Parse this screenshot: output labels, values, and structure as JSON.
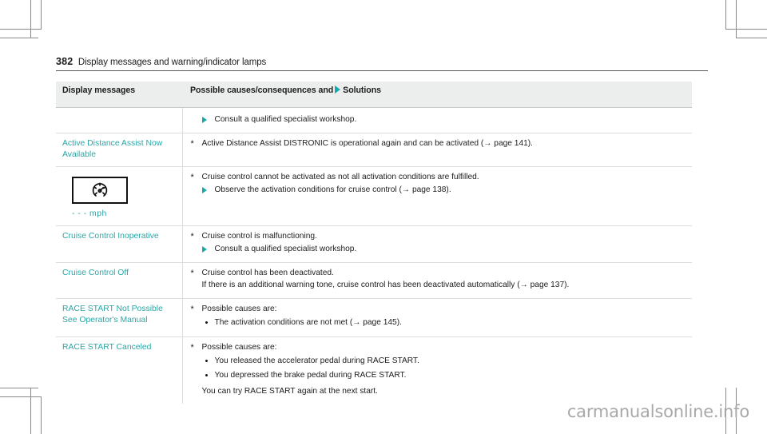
{
  "page": {
    "folio": "382",
    "running_title": "Display messages and warning/indicator lamps",
    "watermark": "carmanualsonline.info"
  },
  "colors": {
    "accent_teal": "#2aa7a6",
    "marker_teal": "#15a9a9",
    "header_bg": "#eceded",
    "rule": "#dcdddd",
    "text": "#1c1c1c"
  },
  "table": {
    "headers": {
      "col1": "Display messages",
      "col2_before": "Possible causes/consequences and",
      "col2_after": "Solutions"
    },
    "rows": [
      {
        "message": "",
        "icon": null,
        "lines": [
          {
            "kind": "solution",
            "text": "Consult a qualified specialist workshop."
          }
        ]
      },
      {
        "message": "Active Distance Assist Now Available",
        "icon": null,
        "lines": [
          {
            "kind": "star",
            "text": "Active Distance Assist DISTRONIC is operational again and can be activated (→ page 141)."
          }
        ]
      },
      {
        "message": "",
        "icon": {
          "name": "speedometer-icon",
          "unit_label": "- - - mph"
        },
        "lines": [
          {
            "kind": "star",
            "text": "Cruise control cannot be activated as not all activation conditions are fulfilled."
          },
          {
            "kind": "solution",
            "text": "Observe the activation conditions for cruise control (→ page 138)."
          }
        ]
      },
      {
        "message": "Cruise Control Inoperative",
        "icon": null,
        "lines": [
          {
            "kind": "star",
            "text": "Cruise control is malfunctioning."
          },
          {
            "kind": "solution",
            "text": "Consult a qualified specialist workshop."
          }
        ]
      },
      {
        "message": "Cruise Control Off",
        "icon": null,
        "lines": [
          {
            "kind": "star",
            "text": "Cruise control has been deactivated."
          },
          {
            "kind": "plain",
            "text": "If there is an additional warning tone, cruise control has been deactivated automatically (→ page 137)."
          }
        ]
      },
      {
        "message": "RACE START Not Possible See Operator's Manual",
        "icon": null,
        "lines": [
          {
            "kind": "star",
            "text": "Possible causes are:"
          },
          {
            "kind": "dot",
            "text": "The activation conditions are not met (→ page 145)."
          }
        ]
      },
      {
        "message": "RACE START Canceled",
        "icon": null,
        "lines": [
          {
            "kind": "star",
            "text": "Possible causes are:"
          },
          {
            "kind": "dot",
            "text": "You released the accelerator pedal during RACE START."
          },
          {
            "kind": "dot",
            "text": "You depressed the brake pedal during RACE START."
          },
          {
            "kind": "tail",
            "text": "You can try RACE START again at the next start."
          }
        ]
      }
    ]
  }
}
